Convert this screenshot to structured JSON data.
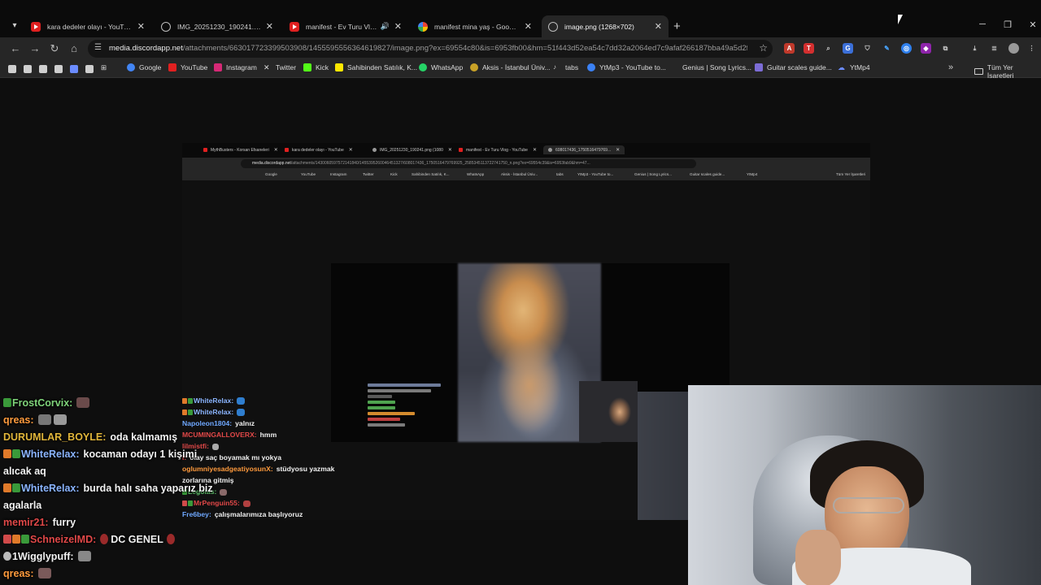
{
  "browser": {
    "tabs": [
      {
        "title": "kara dedeler olayı - YouTube",
        "icon": "youtube-icon"
      },
      {
        "title": "IMG_20251230_190241.png (1080",
        "icon": "globe-icon"
      },
      {
        "title": "manifest - Ev Turu Vlog - YouTube",
        "icon": "youtube-icon"
      },
      {
        "title": "manifest mina yaş - Google'da Ara",
        "icon": "google-icon"
      },
      {
        "title": "image.png (1268×702)",
        "icon": "globe-icon"
      }
    ],
    "new_tab": "+",
    "url_host": "media.discordapp.net",
    "url_rest": "/attachments/663017723399503908/1455595556364619827/image.png?ex=69554c80&is=6953fb00&hm=51f443d52ea54c7dd32a2064ed7c9afaf266187bba49a5d2f7aa...",
    "bookmarks": [
      {
        "label": "Google",
        "color": "#4285f4"
      },
      {
        "label": "YouTube",
        "color": "#e02020"
      },
      {
        "label": "Instagram",
        "color": "#d62976"
      },
      {
        "label": "Twitter",
        "color": "#dcdcdc"
      },
      {
        "label": "Kick",
        "color": "#53fc18"
      },
      {
        "label": "Sahibinden Satılık, K...",
        "color": "#ffe800"
      },
      {
        "label": "WhatsApp",
        "color": "#25d366"
      },
      {
        "label": "Aksis - İstanbul Üniv...",
        "color": "#c9a227"
      },
      {
        "label": "tabs",
        "color": "#cfcfcf"
      },
      {
        "label": "YtMp3 - YouTube to...",
        "color": "#3b82f6"
      },
      {
        "label": "Genius | Song Lyrics...",
        "color": "#ffff64"
      },
      {
        "label": "Guitar scales guide...",
        "color": "#7c6cd6"
      },
      {
        "label": "YtMp4",
        "color": "#6b8cff"
      }
    ],
    "all_bookmarks": "Tüm Yer İşaretleri"
  },
  "inner_browser": {
    "tabs": [
      "MythBusters - Korsan Efsaneleri",
      "kara dedeler olayı - YouTube",
      "IMG_20251230_190241.png (1080",
      "manifest - Ev Turu Vlog - YouTube",
      "608017436_1750516479769..."
    ],
    "url_host": "media.discordapp.net",
    "url_rest": "/attachments/1430060597572141840/1455395260046451327/608017436_1750516479769925_2585345113722741750_n.png?ex=69554c39&is=6953fab9&hm=47...",
    "bookmarks": [
      "Google",
      "YouTube",
      "Instagram",
      "Twitter",
      "Kick",
      "Sahibinden Satılık, K...",
      "WhatsApp",
      "Aksis - İstanbul Üniv...",
      "tabs",
      "YtMp3 - YouTube to...",
      "Genius | Song Lyrics...",
      "Guitar scales guide...",
      "YtMp4",
      "Tüm Yer İşaretleri"
    ],
    "chat": [
      {
        "user": "WhiteRelax:",
        "msg": "",
        "color": "#8ab4ff"
      },
      {
        "user": "WhiteRelax:",
        "msg": "",
        "color": "#8ab4ff"
      },
      {
        "user": "Napoleon1804:",
        "msg": "yalnız",
        "color": "#6fa8ff"
      },
      {
        "user": "MCUMINGALLOVERX:",
        "msg": "hmm",
        "color": "#e24848"
      },
      {
        "user": "lilmistfi:",
        "msg": "",
        "color": "#e24848"
      },
      {
        "user": "l:",
        "msg": "olay saç boyamak mı yokya",
        "color": "#e24848"
      },
      {
        "user": "oglumniyesadgeatiyosunX:",
        "msg": "stüdyosu yazmak",
        "color": "#ff9a3c"
      },
      {
        "user": "",
        "msg": "zorlarına gitmiş",
        "color": "#f0f0f0"
      },
      {
        "user": "Legolas:",
        "msg": "",
        "color": "#5ec26a"
      },
      {
        "user": "MrPenguin55:",
        "msg": "",
        "color": "#e24848"
      },
      {
        "user": "Fre6bey:",
        "msg": "çalışmalarımıza başlıyoruz",
        "color": "#6fa8ff"
      }
    ]
  },
  "chat": [
    {
      "user": "FrostCorvix:",
      "msg": "",
      "color": "#7fd37a"
    },
    {
      "user": "qreas:",
      "msg": "",
      "color": "#ff9b3d"
    },
    {
      "user": "DURUMLAR_BOYLE:",
      "msg": "oda kalmamış",
      "color": "#e0b53a"
    },
    {
      "user": "WhiteRelax:",
      "msg": "kocaman odayı 1 kişimi",
      "color": "#8ab4ff"
    },
    {
      "user": "",
      "msg": "alıcak aq",
      "color": "#f2f2f2"
    },
    {
      "user": "WhiteRelax:",
      "msg": "burda halı saha yaparız biz",
      "color": "#8ab4ff"
    },
    {
      "user": "",
      "msg": "agalarla",
      "color": "#f2f2f2"
    },
    {
      "user": "memir21:",
      "msg": "furry",
      "color": "#e04848"
    },
    {
      "user": "SchneizelMD:",
      "msg": "DC GENEL",
      "color": "#e04848"
    },
    {
      "user": "1Wigglypuff:",
      "msg": "",
      "color": "#f2f2f2"
    },
    {
      "user": "qreas:",
      "msg": "",
      "color": "#ff9b3d"
    }
  ]
}
